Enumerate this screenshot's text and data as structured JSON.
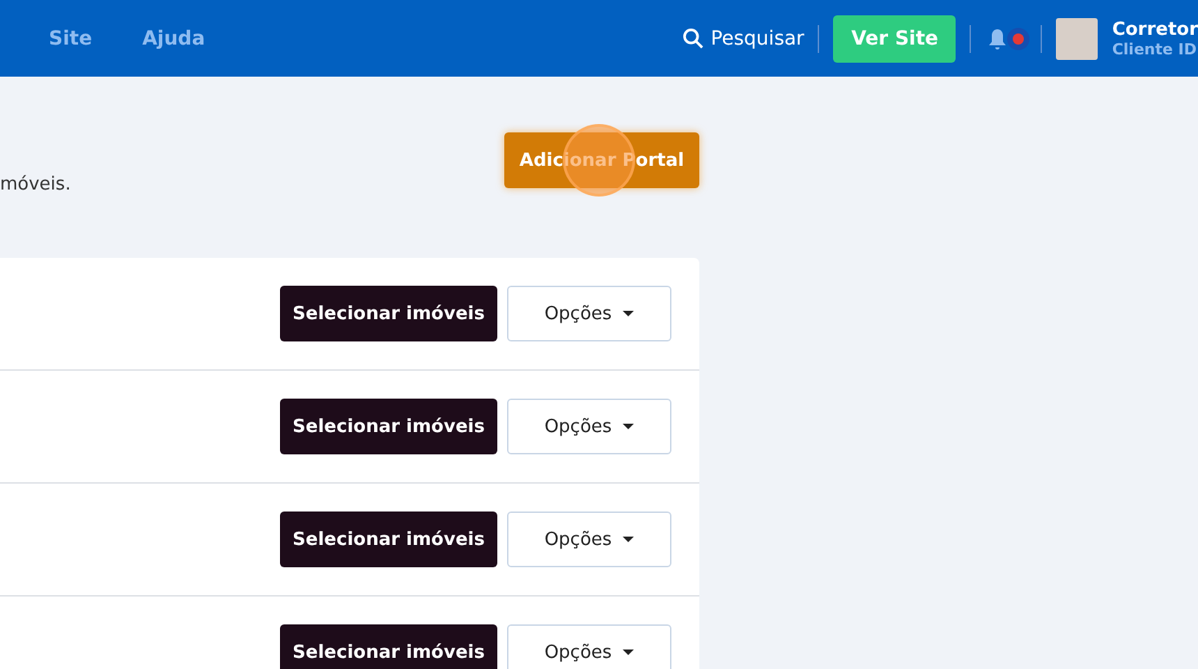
{
  "nav": [
    {
      "label": "Site"
    },
    {
      "label": "Ajuda"
    }
  ],
  "search": {
    "label": "Pesquisar"
  },
  "view_site": {
    "label": "Ver Site"
  },
  "notifications": {
    "unread": true
  },
  "user": {
    "name": "Corretor",
    "subtitle": "Cliente ID"
  },
  "intro": {
    "text": "móveis."
  },
  "add_portal": {
    "label": "Adicionar Portal",
    "click_highlight": true
  },
  "portals": [
    {
      "select_label": "Selecionar imóveis",
      "options_label": "Opções"
    },
    {
      "select_label": "Selecionar imóveis",
      "options_label": "Opções"
    },
    {
      "select_label": "Selecionar imóveis",
      "options_label": "Opções"
    },
    {
      "select_label": "Selecionar imóveis",
      "options_label": "Opções"
    }
  ]
}
